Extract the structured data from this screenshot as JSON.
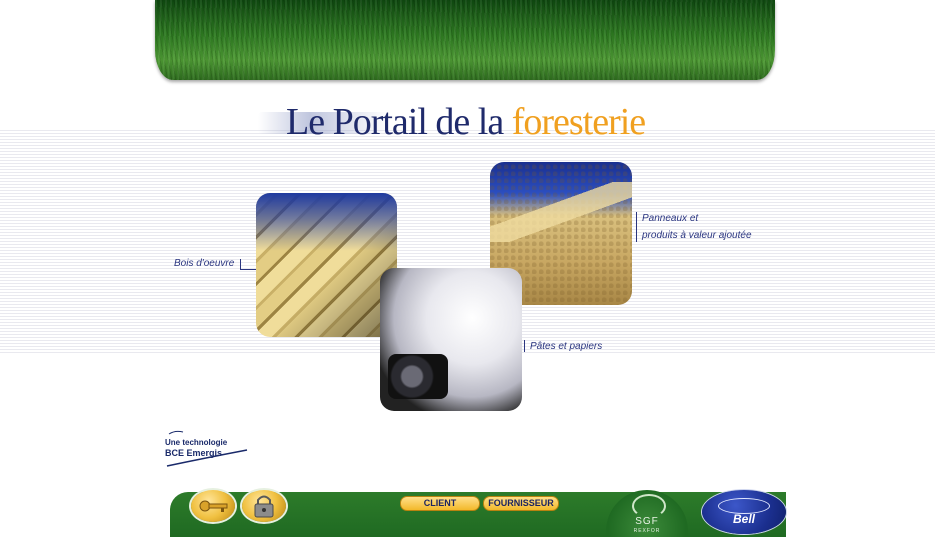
{
  "title": {
    "main": "Le Portail de la",
    "accent": "foresterie"
  },
  "categories": {
    "lumber": "Bois d'oeuvre",
    "panels_line1": "Panneaux et",
    "panels_line2": "produits à valeur ajoutée",
    "paper": "Pâtes et papiers"
  },
  "logo": {
    "line1": "Une technologie",
    "line2": "BCE Emergis"
  },
  "nav": {
    "client": "CLIENT",
    "fournisseur": "FOURNISSEUR",
    "key_icon": "key-icon",
    "lock_icon": "lock-icon"
  },
  "partners": {
    "sgf": "SGF",
    "sgf_sub": "REXFOR",
    "bell": "Bell"
  },
  "colors": {
    "title_blue": "#1f2a6b",
    "title_orange": "#f0a020",
    "bar_green": "#1f6a22",
    "button_gold": "#f3b82a",
    "bell_blue": "#1b2f8f"
  }
}
